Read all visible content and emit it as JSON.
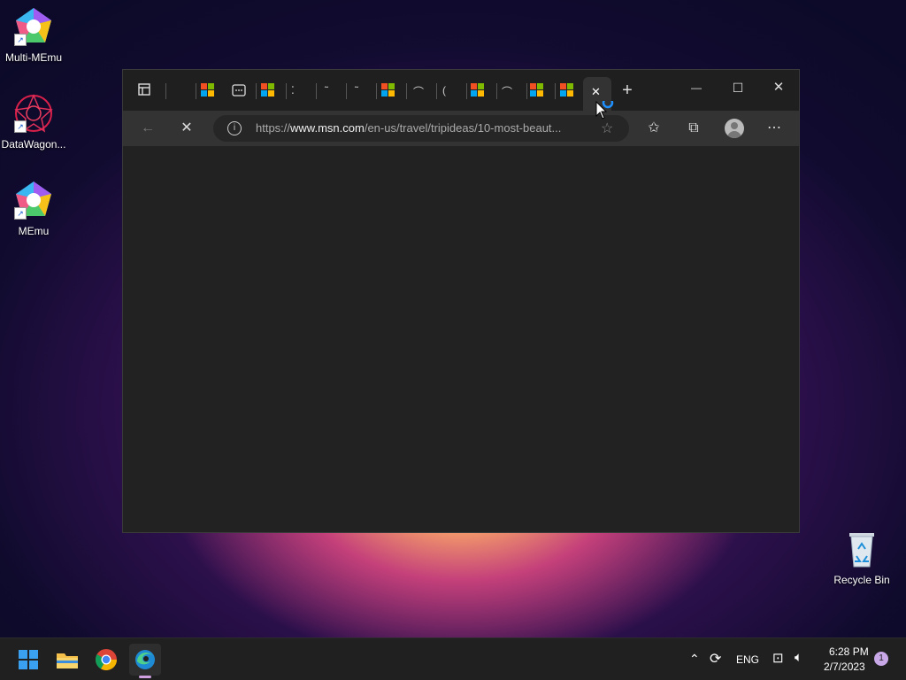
{
  "desktop": {
    "icons": [
      {
        "label": "Multi-MEmu"
      },
      {
        "label": "DataWagon..."
      },
      {
        "label": "MEmu"
      },
      {
        "label": "Recycle Bin"
      }
    ]
  },
  "browser": {
    "url_prefix": "https://",
    "url_domain": "www.msn.com",
    "url_path": "/en-us/travel/tripideas/10-most-beaut...",
    "loading": true,
    "tab_count_visible": 13
  },
  "window_controls": {
    "minimize": "—",
    "maximize": "☐",
    "close": "✕"
  },
  "tray": {
    "language": "ENG",
    "time": "6:28 PM",
    "date": "2/7/2023",
    "notification_count": "1"
  },
  "colors": {
    "accent": "#0078d4",
    "titlebar": "#1f1f1f",
    "navbar": "#333333"
  }
}
